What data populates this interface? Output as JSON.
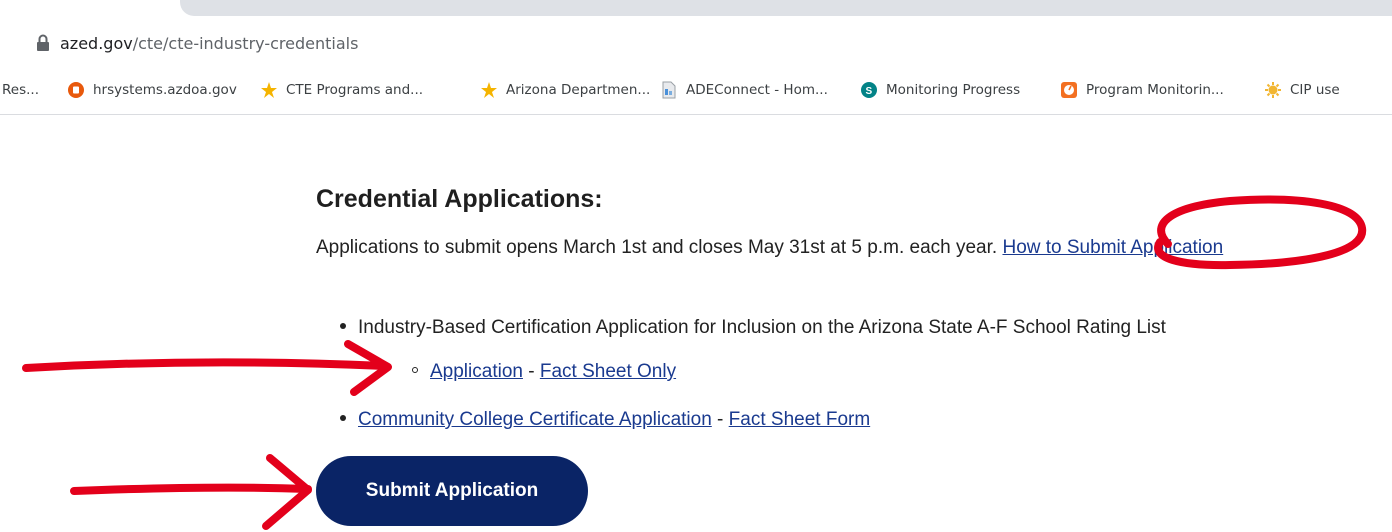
{
  "browser": {
    "url_host": "azed.gov",
    "url_path": "/cte/cte-industry-credentials",
    "bookmarks": [
      {
        "label": "Res...",
        "icon": "bookmark-truncated"
      },
      {
        "label": "hrsystems.azdoa.gov",
        "icon": "orange-circle-icon",
        "color": "#e8590c"
      },
      {
        "label": "CTE Programs and...",
        "icon": "yellow-star-icon",
        "color": "#f5b400"
      },
      {
        "label": "Arizona Departmen...",
        "icon": "yellow-star-icon",
        "color": "#f5b400"
      },
      {
        "label": "ADEConnect - Hom...",
        "icon": "document-icon"
      },
      {
        "label": "Monitoring Progress",
        "icon": "sharepoint-icon",
        "color": "#038387"
      },
      {
        "label": "Program Monitorin...",
        "icon": "orange-clock-icon",
        "color": "#f37021"
      },
      {
        "label": "CIP use",
        "icon": "gear-sun-icon",
        "color": "#f2b632"
      }
    ]
  },
  "page": {
    "heading": "Credential Applications:",
    "intro_text": "Applications to submit opens March 1st and closes May 31st at 5 p.m. each year. ",
    "intro_link": "How to Submit Application",
    "item1_text": "Industry-Based Certification Application for Inclusion on the Arizona State A-F School Rating List",
    "item1_link_app": "Application",
    "sep": " - ",
    "item1_link_fact": "Fact Sheet Only",
    "item2_link_app": "Community College Certificate Application",
    "item2_link_fact": "Fact Sheet Form",
    "submit_label": "Submit Application"
  },
  "colors": {
    "button_bg": "#0a2466",
    "link": "#1a3a8f",
    "annotation": "#e3001b"
  }
}
